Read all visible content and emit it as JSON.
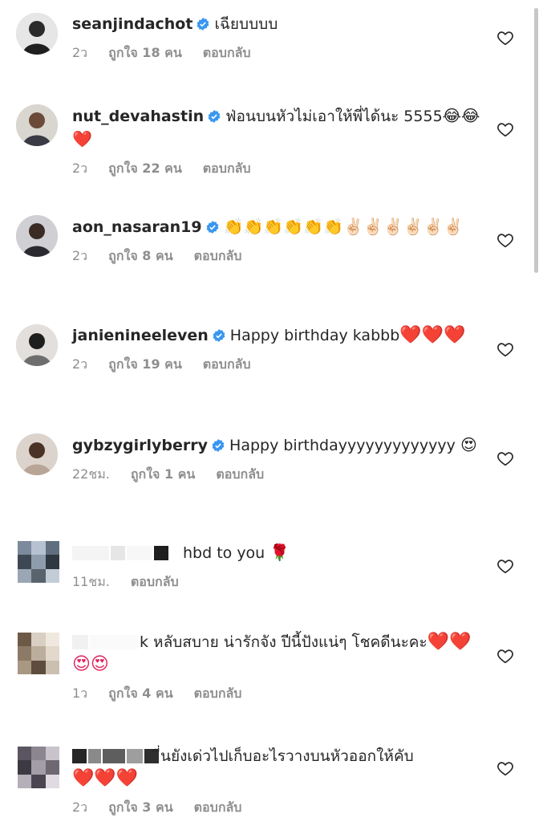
{
  "comments": [
    {
      "username": "seanjindachot",
      "text": "เฉียบบบบ",
      "time": "2ว",
      "likes": "ถูกใจ 18 คน",
      "reply": "ตอบกลับ"
    },
    {
      "username": "nut_devahastin",
      "text": "ฟ่อนบนหัวไม่เอาให้พี่ได้นะ 5555",
      "emojis": "😂😂❤️",
      "time": "2ว",
      "likes": "ถูกใจ 22 คน",
      "reply": "ตอบกลับ"
    },
    {
      "username": "aon_nasaran19",
      "emojis": "👏👏👏👏👏👏✌🏻✌🏻✌🏻✌🏻✌🏻✌🏻",
      "time": "2ว",
      "likes": "ถูกใจ 8 คน",
      "reply": "ตอบกลับ"
    },
    {
      "username": "janienineeleven",
      "text": "Happy birthday kabbb",
      "emojis": "❤️❤️❤️",
      "time": "2ว",
      "likes": "ถูกใจ 19 คน",
      "reply": "ตอบกลับ"
    },
    {
      "username": "gybzygirlyberry",
      "text": "Happy birthdayyyyyyyyyyyyy",
      "emojis": "😍",
      "time": "22ชม.",
      "likes": "ถูกใจ 1 คน",
      "reply": "ตอบกลับ"
    },
    {
      "text": "hbd to you",
      "emojis": "🌹",
      "time": "11ชม.",
      "reply": "ตอบกลับ"
    },
    {
      "text": "k หลับสบาย น่ารักจัง ปีนี้ปังแน่ๆ  โชคดีนะคะ",
      "emojis": "❤️❤️😍😍",
      "time": "1ว",
      "likes": "ถูกใจ 4 คน",
      "reply": "ตอบกลับ"
    },
    {
      "text": "ี่นยังเด่วไปเก็บอะไรวางบนหัวออกให้คับ",
      "emojis": "❤️❤️❤️",
      "time": "2ว",
      "likes": "ถูกใจ 3 คน",
      "reply": "ตอบกลับ"
    }
  ],
  "colors": {
    "verified": "#3897f0",
    "meta": "#8e8e8e",
    "text": "#262626"
  },
  "icons": [
    "verified-badge-icon",
    "heart-outline-icon"
  ]
}
